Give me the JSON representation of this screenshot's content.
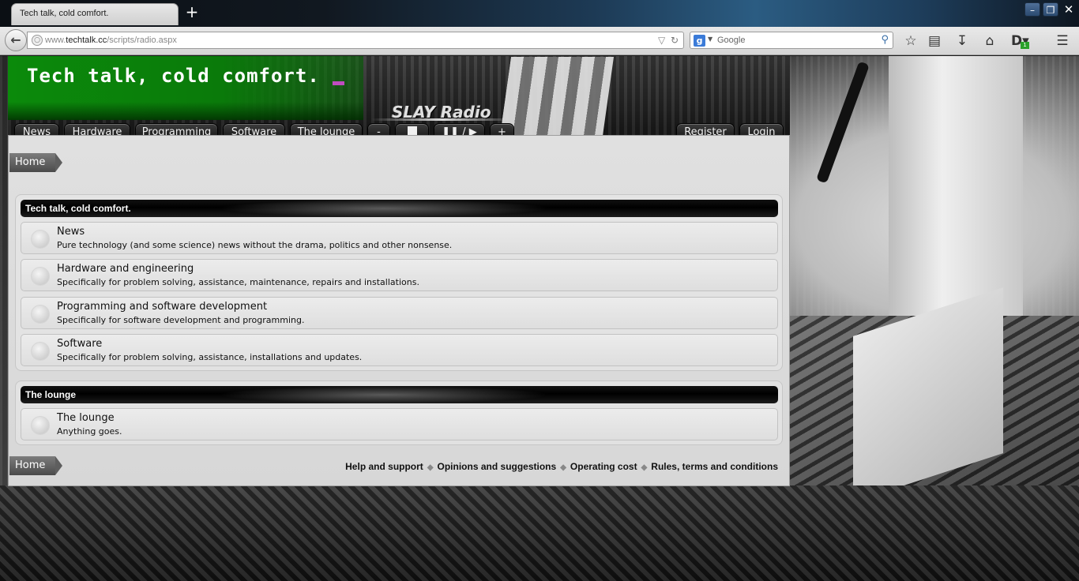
{
  "browser": {
    "tab_title": "Tech talk, cold comfort.",
    "new_tab": "+",
    "url_prefix": "www.",
    "url_host": "techtalk.cc",
    "url_path": "/scripts/radio.aspx",
    "search_engine_icon": "google-icon",
    "search_placeholder": "Google",
    "downloads_badge": "1",
    "window_buttons": [
      "minimize-icon",
      "restore-icon",
      "close-icon"
    ]
  },
  "site": {
    "title": "Tech talk, cold comfort.",
    "logo_text": "SLAY Radio",
    "nav": {
      "news": "News",
      "hardware": "Hardware",
      "programming": "Programming",
      "software": "Software",
      "lounge": "The lounge",
      "vol_down": "-",
      "pause_play": "/",
      "vol_up": "+",
      "register": "Register",
      "login": "Login"
    }
  },
  "breadcrumb": {
    "home": "Home"
  },
  "categories": [
    {
      "title": "Tech talk, cold comfort.",
      "forums": [
        {
          "title": "News",
          "desc": "Pure technology (and some science) news without the drama, politics and other nonsense."
        },
        {
          "title": "Hardware and engineering",
          "desc": "Specifically for problem solving, assistance, maintenance, repairs and installations."
        },
        {
          "title": "Programming and software development",
          "desc": "Specifically for software development and programming."
        },
        {
          "title": "Software",
          "desc": "Specifically for problem solving, assistance, installations and updates."
        }
      ]
    },
    {
      "title": "The lounge",
      "forums": [
        {
          "title": "The lounge",
          "desc": "Anything goes."
        }
      ]
    }
  ],
  "footer": {
    "help": "Help and support",
    "opinions": "Opinions and suggestions",
    "cost": "Operating cost",
    "rules": "Rules, terms and conditions"
  },
  "colors": {
    "header_green": "#0b8a0b",
    "cursor_magenta": "#c04cc0",
    "panel_bg": "#dcdcdc",
    "button_dark": "#1a1a1a"
  }
}
